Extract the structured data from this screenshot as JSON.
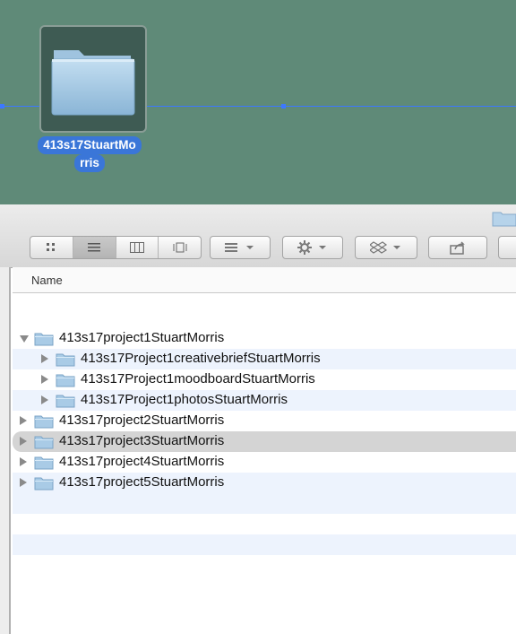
{
  "desktop": {
    "folder_label_line1": "413s17StuartMo",
    "folder_label_line2": "rris",
    "icon": "folder-icon",
    "background_color": "#5f8a78"
  },
  "toolbar": {
    "view_buttons": [
      "icon-view-icon",
      "list-view-icon",
      "column-view-icon",
      "cover-flow-view-icon"
    ],
    "active_view": "list-view-icon",
    "arrange_icon": "arrange-icon",
    "action_icon": "gear-icon",
    "dropbox_icon": "dropbox-icon",
    "share_icon": "share-icon"
  },
  "list": {
    "header_name": "Name",
    "rows": [
      {
        "name": "413s17project1StuartMorris",
        "level": 0,
        "expanded": true,
        "selected": false
      },
      {
        "name": "413s17Project1creativebriefStuartMorris",
        "level": 1,
        "expanded": false,
        "selected": false
      },
      {
        "name": "413s17Project1moodboardStuartMorris",
        "level": 1,
        "expanded": false,
        "selected": false
      },
      {
        "name": "413s17Project1photosStuartMorris",
        "level": 1,
        "expanded": false,
        "selected": false
      },
      {
        "name": "413s17project2StuartMorris",
        "level": 0,
        "expanded": false,
        "selected": false
      },
      {
        "name": "413s17project3StuartMorris",
        "level": 0,
        "expanded": false,
        "selected": true
      },
      {
        "name": "413s17project4StuartMorris",
        "level": 0,
        "expanded": false,
        "selected": false
      },
      {
        "name": "413s17project5StuartMorris",
        "level": 0,
        "expanded": false,
        "selected": false
      }
    ]
  },
  "colors": {
    "selection_blue": "#3a76d8",
    "row_stripe": "#edf3fd",
    "selected_row": "#d4d4d4",
    "folder_blue": "#9cc3df"
  }
}
